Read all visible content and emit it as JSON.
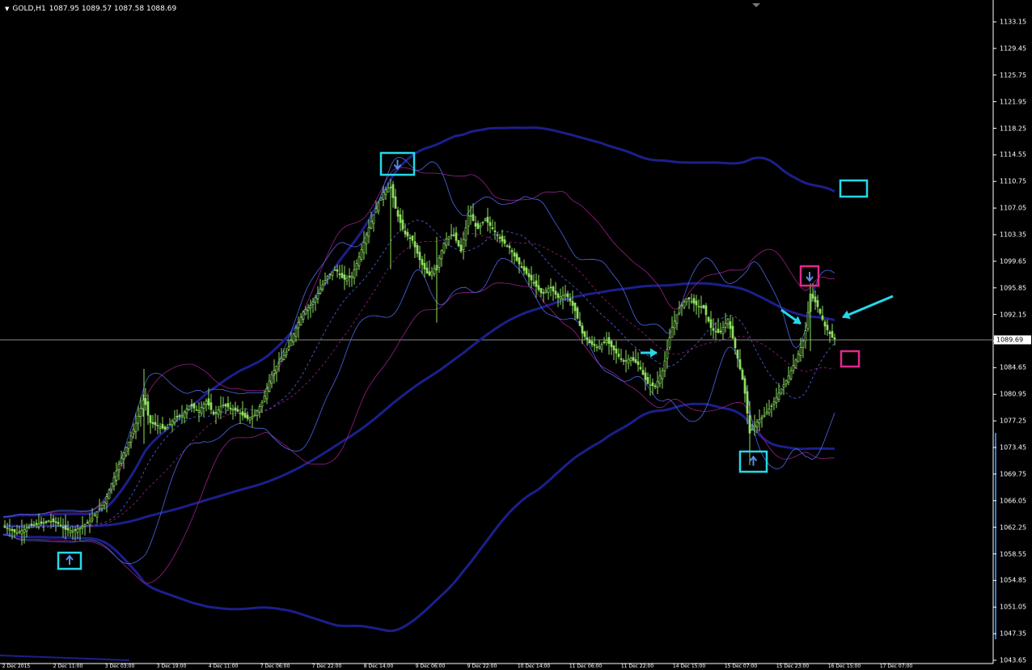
{
  "window": {
    "symbol": "GOLD,H1",
    "ohlc": "1087.95 1089.57 1087.58 1088.69",
    "current_price": "1089.69",
    "menu_icon": "triangle-down-icon"
  },
  "price_axis": {
    "labels": [
      "1133.15",
      "1129.45",
      "1125.75",
      "1121.95",
      "1118.25",
      "1114.55",
      "1110.75",
      "1107.05",
      "1103.35",
      "1099.65",
      "1095.85",
      "1092.15",
      "1088.45",
      "1084.65",
      "1080.95",
      "1077.25",
      "1073.45",
      "1069.75",
      "1066.05",
      "1062.25",
      "1058.55",
      "1054.85",
      "1051.05",
      "1047.35",
      "1043.65"
    ]
  },
  "time_axis": {
    "labels": [
      "2 Dec 2015",
      "2 Dec 11:00",
      "3 Dec 03:00",
      "3 Dec 19:00",
      "4 Dec 11:00",
      "7 Dec 06:00",
      "7 Dec 22:00",
      "8 Dec 14:00",
      "9 Dec 06:00",
      "9 Dec 22:00",
      "10 Dec 14:00",
      "11 Dec 06:00",
      "11 Dec 22:00",
      "14 Dec 15:00",
      "15 Dec 07:00",
      "15 Dec 23:00",
      "16 Dec 15:00",
      "17 Dec 07:00"
    ]
  },
  "chart_data": {
    "type": "candlestick",
    "symbol": "GOLD",
    "timeframe": "H1",
    "ylim": [
      1043.65,
      1135.0
    ],
    "grid": false,
    "last_close": 1088.69,
    "price_path": [
      [
        0,
        1062.5
      ],
      [
        10,
        1062.2
      ],
      [
        20,
        1061.5
      ],
      [
        30,
        1062.0
      ],
      [
        40,
        1062.6
      ],
      [
        50,
        1062.8
      ],
      [
        60,
        1063.2
      ],
      [
        70,
        1063.0
      ],
      [
        80,
        1062.0
      ],
      [
        90,
        1061.8
      ],
      [
        100,
        1062.3
      ],
      [
        110,
        1063.0
      ],
      [
        120,
        1064.5
      ],
      [
        130,
        1066.0
      ],
      [
        140,
        1069.0
      ],
      [
        150,
        1072.0
      ],
      [
        160,
        1074.5
      ],
      [
        170,
        1077.5
      ],
      [
        178,
        1080.5
      ],
      [
        185,
        1077.0
      ],
      [
        195,
        1076.5
      ],
      [
        205,
        1076.0
      ],
      [
        215,
        1077.5
      ],
      [
        225,
        1078.0
      ],
      [
        235,
        1079.5
      ],
      [
        245,
        1078.5
      ],
      [
        255,
        1080.0
      ],
      [
        265,
        1078.0
      ],
      [
        275,
        1079.5
      ],
      [
        285,
        1079.0
      ],
      [
        295,
        1078.5
      ],
      [
        305,
        1077.5
      ],
      [
        315,
        1078.0
      ],
      [
        325,
        1080.0
      ],
      [
        335,
        1083.5
      ],
      [
        345,
        1085.5
      ],
      [
        355,
        1087.0
      ],
      [
        365,
        1090.0
      ],
      [
        375,
        1092.5
      ],
      [
        385,
        1093.5
      ],
      [
        395,
        1095.5
      ],
      [
        405,
        1097.5
      ],
      [
        415,
        1098.5
      ],
      [
        425,
        1097.0
      ],
      [
        435,
        1097.5
      ],
      [
        445,
        1100.5
      ],
      [
        455,
        1104.0
      ],
      [
        465,
        1107.0
      ],
      [
        475,
        1109.5
      ],
      [
        483,
        1110.0
      ],
      [
        490,
        1106.5
      ],
      [
        500,
        1103.5
      ],
      [
        510,
        1102.5
      ],
      [
        520,
        1099.5
      ],
      [
        530,
        1097.5
      ],
      [
        540,
        1099.0
      ],
      [
        550,
        1102.5
      ],
      [
        560,
        1103.5
      ],
      [
        570,
        1101.0
      ],
      [
        580,
        1106.5
      ],
      [
        590,
        1104.0
      ],
      [
        600,
        1105.5
      ],
      [
        610,
        1104.0
      ],
      [
        620,
        1102.5
      ],
      [
        630,
        1101.5
      ],
      [
        640,
        1099.5
      ],
      [
        650,
        1098.0
      ],
      [
        660,
        1096.5
      ],
      [
        670,
        1095.0
      ],
      [
        680,
        1096.0
      ],
      [
        690,
        1094.5
      ],
      [
        700,
        1095.0
      ],
      [
        710,
        1093.0
      ],
      [
        720,
        1089.5
      ],
      [
        730,
        1088.0
      ],
      [
        740,
        1087.5
      ],
      [
        750,
        1088.5
      ],
      [
        760,
        1087.0
      ],
      [
        770,
        1085.5
      ],
      [
        780,
        1086.0
      ],
      [
        790,
        1085.0
      ],
      [
        800,
        1082.5
      ],
      [
        810,
        1082.0
      ],
      [
        820,
        1084.5
      ],
      [
        830,
        1090.0
      ],
      [
        840,
        1093.0
      ],
      [
        850,
        1094.5
      ],
      [
        860,
        1093.5
      ],
      [
        870,
        1093.0
      ],
      [
        880,
        1090.0
      ],
      [
        890,
        1089.5
      ],
      [
        900,
        1091.5
      ],
      [
        910,
        1087.0
      ],
      [
        920,
        1082.0
      ],
      [
        927,
        1075.5
      ],
      [
        935,
        1077.0
      ],
      [
        945,
        1078.0
      ],
      [
        955,
        1079.5
      ],
      [
        965,
        1081.5
      ],
      [
        975,
        1083.5
      ],
      [
        985,
        1086.0
      ],
      [
        995,
        1089.0
      ],
      [
        1002,
        1095.0
      ],
      [
        1010,
        1093.5
      ],
      [
        1020,
        1090.5
      ],
      [
        1030,
        1088.7
      ]
    ],
    "indicators": [
      {
        "name": "MA",
        "color": "#1c1f8c"
      },
      {
        "name": "Bollinger Bands",
        "color": "#1c1f8c"
      },
      {
        "name": "Bollinger Bands",
        "color": "#4d66e6"
      },
      {
        "name": "Bollinger Bands",
        "color": "#9a1f8a"
      }
    ],
    "annotations": [
      {
        "type": "box",
        "icon": "arrow-up-icon",
        "color": "#27d8e8"
      },
      {
        "type": "box",
        "icon": "arrow-down-icon",
        "color": "#27d8e8"
      },
      {
        "type": "box",
        "icon": "arrow-up-icon",
        "color": "#27d8e8"
      },
      {
        "type": "box",
        "icon": "arrow-down-icon",
        "color": "#e0288a"
      },
      {
        "type": "box",
        "icon": "",
        "color": "#27d8e8"
      },
      {
        "type": "box",
        "icon": "",
        "color": "#e0288a"
      },
      {
        "type": "arrow",
        "color": "#27d8e8"
      },
      {
        "type": "arrow",
        "color": "#27d8e8"
      },
      {
        "type": "arrow",
        "color": "#27d8e8"
      }
    ]
  },
  "colors": {
    "background": "#000000",
    "bull_candle": "#8ee060",
    "text": "#ffffff",
    "annotation_cyan": "#27d8e8",
    "annotation_magenta": "#e0288a"
  }
}
